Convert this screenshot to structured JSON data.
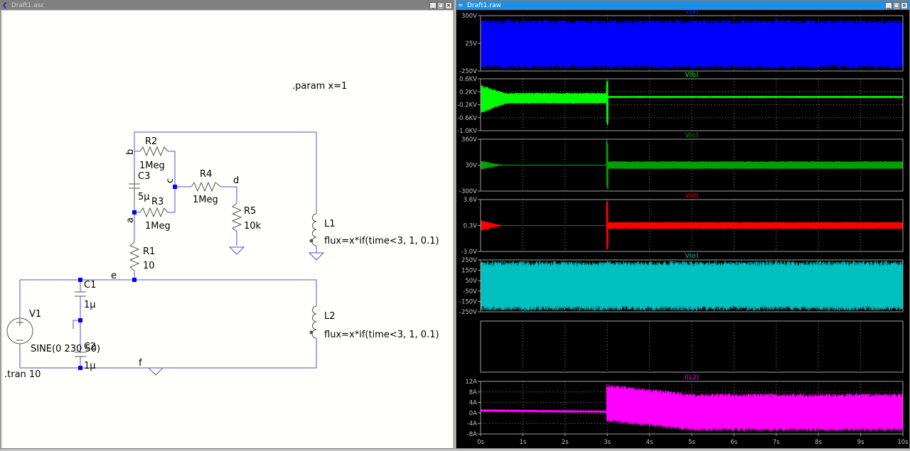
{
  "schematic_window": {
    "title": "Draft1.asc",
    "labels": {
      "param": ".param x=1",
      "tran": ".tran 10",
      "R2": "R2",
      "R2_val": "1Meg",
      "C3": "C3",
      "C3_val": "5µ",
      "R3": "R3",
      "R3_val": "1Meg",
      "R4": "R4",
      "R4_val": "1Meg",
      "R5": "R5",
      "R5_val": "10k",
      "R1": "R1",
      "R1_val": "10",
      "C1": "C1",
      "C1_val": "1µ",
      "C2": "C2",
      "C2_val": "1µ",
      "V1": "V1",
      "V1_val": "SINE(0 230 50)",
      "L1": "L1",
      "L1_val": "flux=x*if(time<3, 1, 0.1)",
      "L2": "L2",
      "L2_val": "flux=x*if(time<3, 1, 0.1)",
      "node_a": "a",
      "node_b": "b",
      "node_c": "c",
      "node_d": "d",
      "node_e": "e",
      "node_f": "f"
    },
    "colors": {
      "wire": "#5050d0",
      "component": "#555555",
      "junction": "#0000ff"
    }
  },
  "plot_window": {
    "title": "Draft1.raw",
    "x_axis": {
      "unit": "s",
      "range": [
        0,
        10
      ],
      "ticks": [
        "0s",
        "1s",
        "2s",
        "3s",
        "4s",
        "5s",
        "6s",
        "7s",
        "8s",
        "9s",
        "10s"
      ]
    },
    "panes": [
      {
        "trace": "V(a)",
        "color": "#0000ff",
        "ylim": [
          -250,
          300
        ],
        "ticks": [
          {
            "v": 300,
            "label": "300V"
          },
          {
            "v": 25,
            "label": "25V"
          },
          {
            "v": -250,
            "label": "-250V"
          }
        ],
        "envelope": [
          {
            "t": [
              0,
              10
            ],
            "min": [
              -230,
              -230
            ],
            "max": [
              260,
              260
            ]
          }
        ]
      },
      {
        "trace": "V(b)",
        "color": "#00ff00",
        "ylim": [
          -1000,
          600
        ],
        "ticks": [
          {
            "v": 600,
            "label": "0.6KV"
          },
          {
            "v": 200,
            "label": "0.2KV"
          },
          {
            "v": -200,
            "label": "-0.2KV"
          },
          {
            "v": -600,
            "label": "-0.6KV"
          },
          {
            "v": -1000,
            "label": "-1.0KV"
          }
        ],
        "envelope": [
          {
            "t": [
              0,
              0.6
            ],
            "min": [
              -480,
              -170
            ],
            "max": [
              420,
              170
            ]
          },
          {
            "t": [
              0.6,
              2.98
            ],
            "min": [
              -170,
              -170
            ],
            "max": [
              170,
              170
            ]
          },
          {
            "t": [
              2.98,
              3.02
            ],
            "min": [
              -900,
              -900
            ],
            "max": [
              580,
              580
            ]
          },
          {
            "t": [
              3.02,
              10
            ],
            "min": [
              30,
              30
            ],
            "max": [
              50,
              50
            ]
          }
        ]
      },
      {
        "trace": "V(c)",
        "color": "#00a000",
        "ylim": [
          -300,
          360
        ],
        "ticks": [
          {
            "v": 360,
            "label": "360V"
          },
          {
            "v": 30,
            "label": "30V"
          },
          {
            "v": -300,
            "label": "-300V"
          }
        ],
        "envelope": [
          {
            "t": [
              0,
              0.5
            ],
            "min": [
              -30,
              28
            ],
            "max": [
              90,
              32
            ]
          },
          {
            "t": [
              0.5,
              2.98
            ],
            "min": [
              29,
              29
            ],
            "max": [
              31,
              31
            ]
          },
          {
            "t": [
              2.98,
              3.02
            ],
            "min": [
              -300,
              -300
            ],
            "max": [
              360,
              360
            ]
          },
          {
            "t": [
              3.02,
              10
            ],
            "min": [
              -20,
              -20
            ],
            "max": [
              80,
              80
            ]
          }
        ]
      },
      {
        "trace": "V(d)",
        "color": "#ff0000",
        "ylim": [
          -3,
          3.6
        ],
        "ticks": [
          {
            "v": 3.6,
            "label": "3.6V"
          },
          {
            "v": 0.3,
            "label": "0.3V"
          },
          {
            "v": -3.0,
            "label": "-3.0V"
          }
        ],
        "envelope": [
          {
            "t": [
              0,
              0.5
            ],
            "min": [
              -0.4,
              0.28
            ],
            "max": [
              1.0,
              0.32
            ]
          },
          {
            "t": [
              0.5,
              2.98
            ],
            "min": [
              0.29,
              0.29
            ],
            "max": [
              0.31,
              0.31
            ]
          },
          {
            "t": [
              2.98,
              3.02
            ],
            "min": [
              -2.9,
              -2.9
            ],
            "max": [
              3.5,
              3.5
            ]
          },
          {
            "t": [
              3.02,
              10
            ],
            "min": [
              -0.15,
              -0.15
            ],
            "max": [
              0.75,
              0.75
            ]
          }
        ]
      },
      {
        "trace": "V(e)",
        "color": "#00c0c0",
        "ylim": [
          -250,
          250
        ],
        "ticks": [
          {
            "v": 250,
            "label": "250V"
          },
          {
            "v": 150,
            "label": "150V"
          },
          {
            "v": 50,
            "label": "50V"
          },
          {
            "v": -50,
            "label": "-50V"
          },
          {
            "v": -150,
            "label": "-150V"
          },
          {
            "v": -250,
            "label": "-250V"
          }
        ],
        "envelope": [
          {
            "t": [
              0,
              10
            ],
            "min": [
              -240,
              -240
            ],
            "max": [
              240,
              240
            ]
          }
        ]
      },
      {
        "trace": "",
        "color": "#000000",
        "ylim": null,
        "ticks": [],
        "envelope": []
      },
      {
        "trace": "I(L2)",
        "color": "#ff00ff",
        "ylim": [
          -8,
          12
        ],
        "ticks": [
          {
            "v": 12,
            "label": "12A"
          },
          {
            "v": 8,
            "label": "8A"
          },
          {
            "v": 4,
            "label": "4A"
          },
          {
            "v": 0,
            "label": "0A"
          },
          {
            "v": -4,
            "label": "-4A"
          },
          {
            "v": -8,
            "label": "-8A"
          }
        ],
        "envelope": [
          {
            "t": [
              0,
              2.98
            ],
            "min": [
              0.4,
              0.1
            ],
            "max": [
              1.4,
              0.9
            ]
          },
          {
            "t": [
              2.98,
              5
            ],
            "min": [
              -3.5,
              -7
            ],
            "max": [
              11,
              7.5
            ]
          },
          {
            "t": [
              5,
              10
            ],
            "min": [
              -7,
              -7
            ],
            "max": [
              7.5,
              7.5
            ]
          }
        ]
      }
    ]
  }
}
